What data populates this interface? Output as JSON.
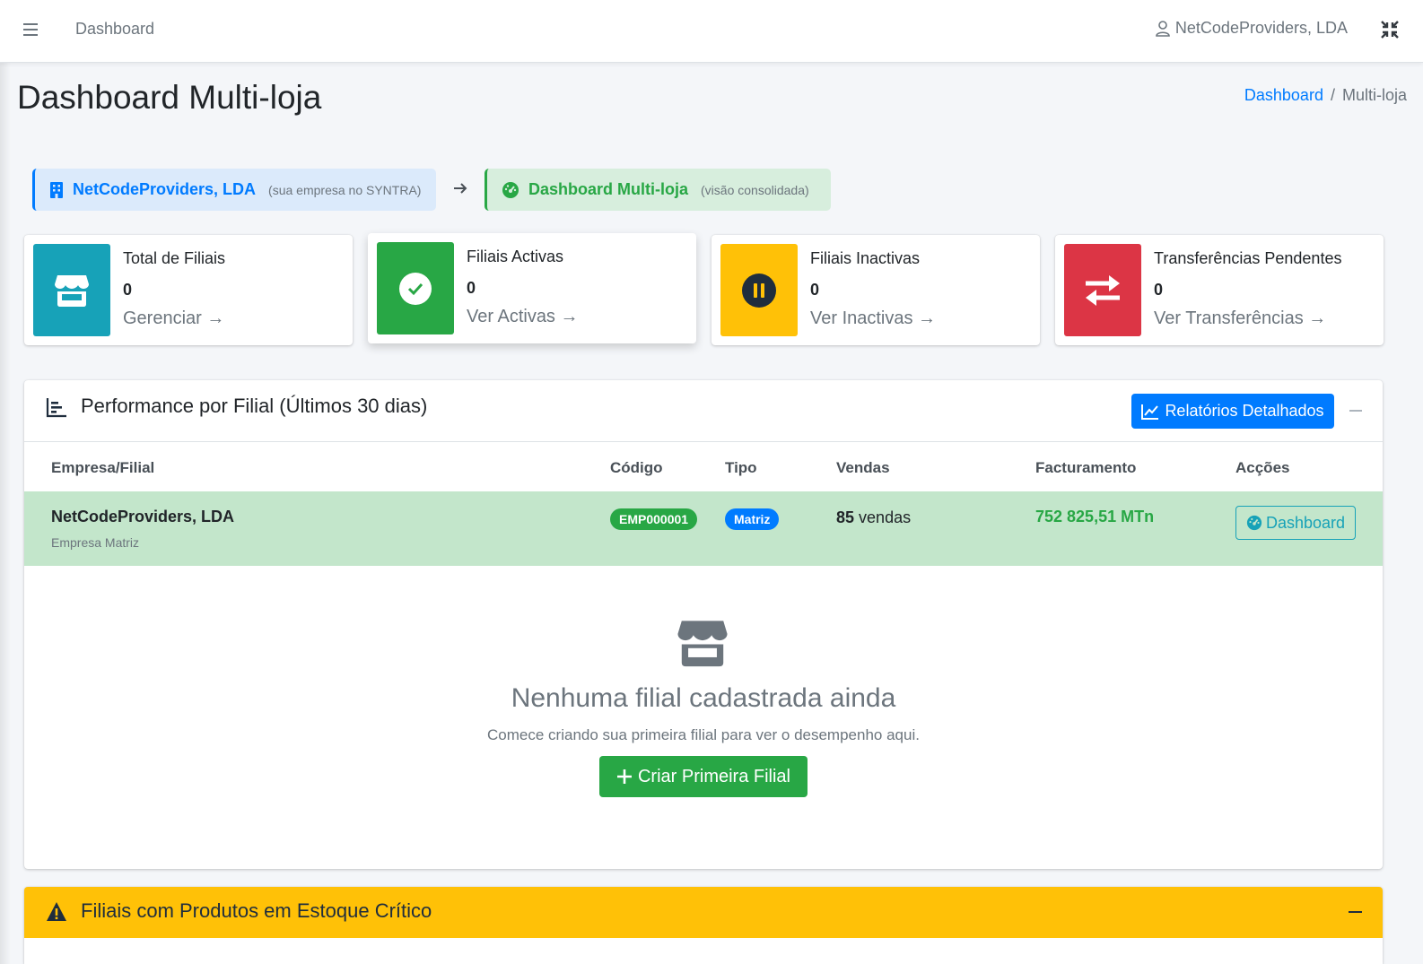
{
  "navbar": {
    "menu_icon": "bars-icon",
    "dashboard_link": "Dashboard",
    "user_name": "NetCodeProviders, LDA",
    "user_icon": "user-icon",
    "expand_icon": "compress-icon"
  },
  "header": {
    "title": "Dashboard Multi-loja",
    "breadcrumb": {
      "link": "Dashboard",
      "separator": "/",
      "current": "Multi-loja"
    }
  },
  "context": {
    "company": {
      "title": "NetCodeProviders, LDA",
      "subtitle": "(sua empresa no SYNTRA)",
      "icon": "building-icon"
    },
    "arrow_icon": "arrow-right-icon",
    "dashboard": {
      "title": "Dashboard Multi-loja",
      "subtitle": "(visão consolidada)",
      "icon": "gauge-icon"
    }
  },
  "info_boxes": [
    {
      "label": "Total de Filiais",
      "value": "0",
      "link": "Gerenciar →",
      "icon": "store-icon",
      "color": "#17a2b8"
    },
    {
      "label": "Filiais Activas",
      "value": "0",
      "link": "Ver Activas →",
      "icon": "check-circle-icon",
      "color": "#28a745"
    },
    {
      "label": "Filiais Inactivas",
      "value": "0",
      "link": "Ver Inactivas →",
      "icon": "pause-circle-icon",
      "color": "#ffc107"
    },
    {
      "label": "Transferências Pendentes",
      "value": "0",
      "link": "Ver Transferências →",
      "icon": "exchange-icon",
      "color": "#dc3545"
    }
  ],
  "performance": {
    "title": "Performance por Filial (Últimos 30 dias)",
    "title_icon": "chart-bar-icon",
    "reports_button": "Relatórios Detalhados",
    "columns": [
      "Empresa/Filial",
      "Código",
      "Tipo",
      "Vendas",
      "Facturamento",
      "Acções"
    ],
    "rows": [
      {
        "name": "NetCodeProviders, LDA",
        "subtitle": "Empresa Matriz",
        "code": "EMP000001",
        "type": "Matriz",
        "sales_count": "85",
        "sales_suffix": "vendas",
        "billing": "752 825,51 MTn",
        "action": "Dashboard"
      }
    ],
    "empty": {
      "icon": "store-icon",
      "title": "Nenhuma filial cadastrada ainda",
      "subtitle": "Comece criando sua primeira filial para ver o desempenho aqui.",
      "button": "Criar Primeira Filial"
    }
  },
  "critical_stock": {
    "title": "Filiais com Produtos em Estoque Crítico",
    "icon": "warning-triangle-icon"
  },
  "colors": {
    "primary": "#007bff",
    "success": "#28a745",
    "info": "#17a2b8",
    "warning": "#ffc107",
    "danger": "#dc3545",
    "row_highlight": "#c3e6cb"
  }
}
